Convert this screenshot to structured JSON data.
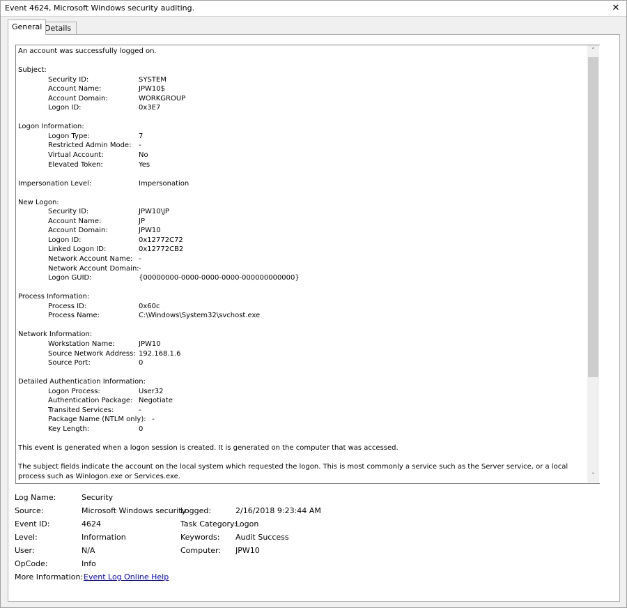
{
  "window": {
    "title": "Event 4624, Microsoft Windows security auditing.",
    "close_glyph": "✕"
  },
  "tabs": [
    {
      "label": "General",
      "active": true
    },
    {
      "label": "Details",
      "active": false
    }
  ],
  "description": {
    "intro": "An account was successfully logged on.",
    "subject_header": "Subject:",
    "subject": [
      {
        "label": "Security ID:",
        "value": "SYSTEM"
      },
      {
        "label": "Account Name:",
        "value": "JPW10$"
      },
      {
        "label": "Account Domain:",
        "value": "WORKGROUP"
      },
      {
        "label": "Logon ID:",
        "value": "0x3E7"
      }
    ],
    "logon_info_header": "Logon Information:",
    "logon_info": [
      {
        "label": "Logon Type:",
        "value": "7"
      },
      {
        "label": "Restricted Admin Mode:",
        "value": "-"
      },
      {
        "label": "Virtual Account:",
        "value": "No"
      },
      {
        "label": "Elevated Token:",
        "value": "Yes"
      }
    ],
    "impersonation_label": "Impersonation Level:",
    "impersonation_value": "Impersonation",
    "new_logon_header": "New Logon:",
    "new_logon": [
      {
        "label": "Security ID:",
        "value": "JPW10\\JP"
      },
      {
        "label": "Account Name:",
        "value": "JP"
      },
      {
        "label": "Account Domain:",
        "value": "JPW10"
      },
      {
        "label": "Logon ID:",
        "value": "0x12772C72"
      },
      {
        "label": "Linked Logon ID:",
        "value": "0x12772CB2"
      },
      {
        "label": "Network Account Name:",
        "value": "-"
      },
      {
        "label": "Network Account Domain:",
        "value": "-"
      },
      {
        "label": "Logon GUID:",
        "value": "{00000000-0000-0000-0000-000000000000}"
      }
    ],
    "process_header": "Process Information:",
    "process": [
      {
        "label": "Process ID:",
        "value": "0x60c"
      },
      {
        "label": "Process Name:",
        "value": "C:\\Windows\\System32\\svchost.exe"
      }
    ],
    "network_header": "Network Information:",
    "network": [
      {
        "label": "Workstation Name:",
        "value": "JPW10"
      },
      {
        "label": "Source Network Address:",
        "value": "192.168.1.6"
      },
      {
        "label": "Source Port:",
        "value": "0"
      }
    ],
    "auth_header": "Detailed Authentication Information:",
    "auth": [
      {
        "label": "Logon Process:",
        "value": "User32"
      },
      {
        "label": "Authentication Package:",
        "value": "Negotiate"
      },
      {
        "label": "Transited Services:",
        "value": "-"
      },
      {
        "label": "Package Name (NTLM only):",
        "value": "      -"
      },
      {
        "label": "Key Length:",
        "value": "0"
      }
    ],
    "para1": "This event is generated when a logon session is created. It is generated on the computer that was accessed.",
    "para2": "The subject fields indicate the account on the local system which requested the logon. This is most commonly a service such as the Server service, or a local process such as Winlogon.exe or Services.exe."
  },
  "scrollbar": {
    "up_glyph": "˄",
    "down_glyph": "˅"
  },
  "meta": {
    "log_name_label": "Log Name:",
    "log_name": "Security",
    "source_label": "Source:",
    "source": "Microsoft Windows security",
    "logged_label": "Logged:",
    "logged": "2/16/2018 9:23:44 AM",
    "event_id_label": "Event ID:",
    "event_id": "4624",
    "task_category_label": "Task Category:",
    "task_category": "Logon",
    "level_label": "Level:",
    "level": "Information",
    "keywords_label": "Keywords:",
    "keywords": "Audit Success",
    "user_label": "User:",
    "user": "N/A",
    "computer_label": "Computer:",
    "computer": "JPW10",
    "opcode_label": "OpCode:",
    "opcode": "Info",
    "more_info_label": "More Information:",
    "more_info_link": "Event Log Online Help"
  }
}
